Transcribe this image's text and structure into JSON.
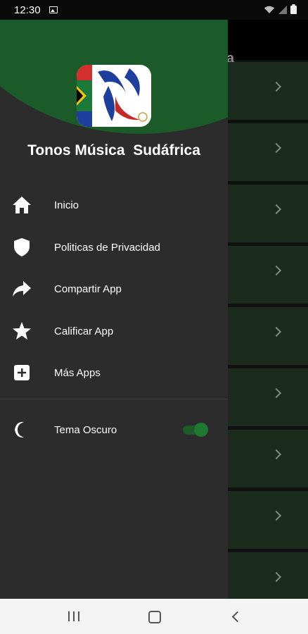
{
  "status_bar": {
    "time": "12:30",
    "icons": [
      "image-icon",
      "wifi-icon",
      "signal-icon",
      "battery-icon"
    ]
  },
  "background_app": {
    "title_fragment": "a",
    "rows": 9
  },
  "drawer": {
    "app_name": "Tonos Música  Sudáfrica",
    "menu": [
      {
        "label": "Inicio",
        "icon": "home-icon"
      },
      {
        "label": "Politicas de Privacidad",
        "icon": "shield-icon"
      },
      {
        "label": "Compartir App",
        "icon": "share-icon"
      },
      {
        "label": "Calificar App",
        "icon": "star-icon"
      },
      {
        "label": "Más Apps",
        "icon": "add-box-icon"
      }
    ],
    "theme": {
      "label": "Tema Oscuro",
      "icon": "moon-icon",
      "enabled": true
    }
  },
  "colors": {
    "header_green": "#1b5b2a",
    "drawer_bg": "#2c2c2c",
    "toggle_on": "#1d7a30"
  },
  "nav_bar": {
    "buttons": [
      "recents-button",
      "home-button",
      "back-button"
    ]
  }
}
